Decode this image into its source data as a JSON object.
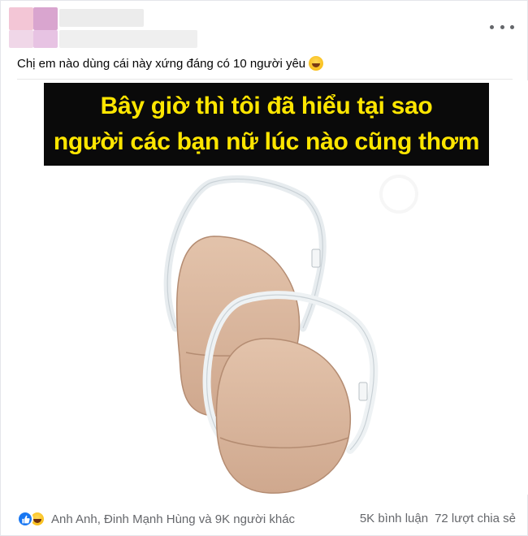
{
  "post": {
    "caption": "Chị em nào dùng cái này xứng đáng có 10 người yêu",
    "caption_emoji": "rolling-on-floor-laughing-emoji"
  },
  "image": {
    "banner_line_1": "Bây giờ thì tôi đã hiểu tại sao",
    "banner_line_2": "người các bạn nữ lúc nào cũng thơm",
    "banner_text_color": "#ffe600",
    "banner_bg_color": "#0a0a0a",
    "pad_color": "#dcb9a0"
  },
  "footer": {
    "reaction_icons": [
      "like-icon",
      "haha-icon"
    ],
    "reactors": "Anh Anh, Đinh Mạnh Hùng và 9K người khác",
    "comments": "5K bình luận",
    "shares": "72 lượt chia sẻ"
  },
  "colors": {
    "like_blue": "#1877f2",
    "secondary_text": "#65676b"
  }
}
